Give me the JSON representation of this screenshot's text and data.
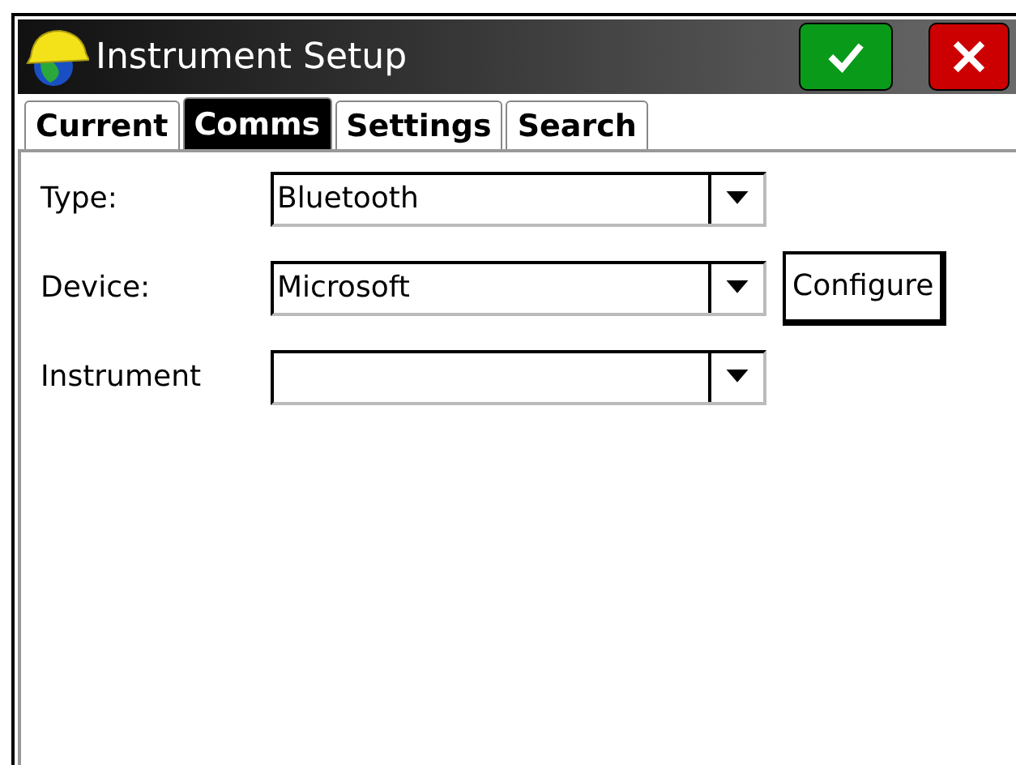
{
  "window": {
    "title": "Instrument Setup"
  },
  "tabs": [
    {
      "label": "Current",
      "selected": false
    },
    {
      "label": "Comms",
      "selected": true
    },
    {
      "label": "Settings",
      "selected": false
    },
    {
      "label": "Search",
      "selected": false
    }
  ],
  "fields": [
    {
      "label": "Type:",
      "value": "Bluetooth"
    },
    {
      "label": "Device:",
      "value": "Microsoft",
      "button": "Configure"
    },
    {
      "label": "Instrument"
    }
  ]
}
